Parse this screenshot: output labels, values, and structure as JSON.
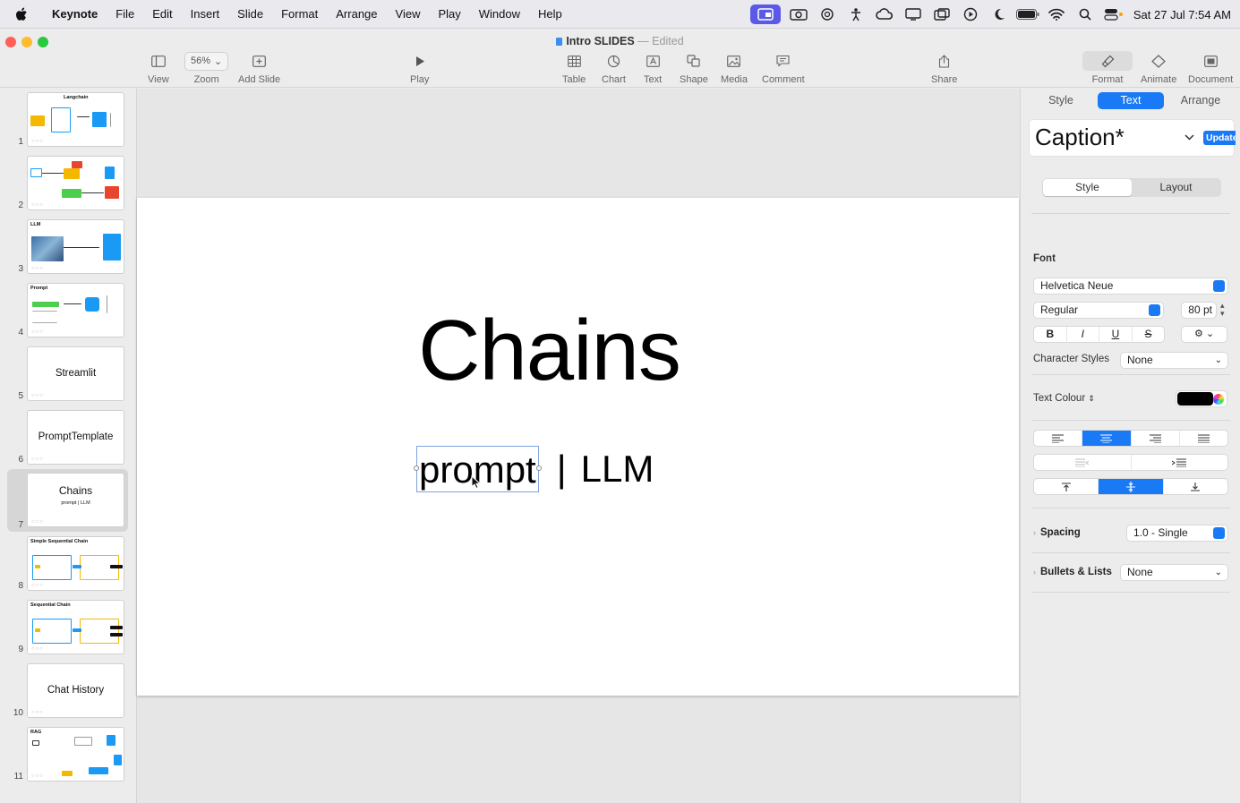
{
  "menubar": {
    "app": "Keynote",
    "items": [
      "File",
      "Edit",
      "Insert",
      "Slide",
      "Format",
      "Arrange",
      "View",
      "Play",
      "Window",
      "Help"
    ],
    "clock": "Sat 27 Jul  7:54 AM"
  },
  "window": {
    "doc_name": "Intro SLIDES",
    "separator": "—",
    "status": "Edited"
  },
  "toolbar": {
    "view": "View",
    "zoom_value": "56%",
    "zoom": "Zoom",
    "add_slide": "Add Slide",
    "play": "Play",
    "table": "Table",
    "chart": "Chart",
    "text": "Text",
    "shape": "Shape",
    "media": "Media",
    "comment": "Comment",
    "share": "Share",
    "format": "Format",
    "animate": "Animate",
    "document": "Document"
  },
  "slides": [
    {
      "num": "1",
      "title": "Langchain"
    },
    {
      "num": "2",
      "title": ""
    },
    {
      "num": "3",
      "title": "LLM"
    },
    {
      "num": "4",
      "title": "Prompt"
    },
    {
      "num": "5",
      "title": "Streamlit"
    },
    {
      "num": "6",
      "title": "PromptTemplate"
    },
    {
      "num": "7",
      "title": "Chains",
      "subtitle": "prompt  |  LLM"
    },
    {
      "num": "8",
      "title": "Simple Sequential Chain"
    },
    {
      "num": "9",
      "title": "Sequential Chain"
    },
    {
      "num": "10",
      "title": "Chat History"
    },
    {
      "num": "11",
      "title": "RAG"
    }
  ],
  "slide": {
    "title": "Chains",
    "sub_word1": "prompt",
    "sub_sep": "|",
    "sub_word2": "LLM"
  },
  "inspector": {
    "tabs": [
      "Style",
      "Text",
      "Arrange"
    ],
    "active_tab": "Text",
    "paragraph_style": "Caption*",
    "update": "Update",
    "subtabs": [
      "Style",
      "Layout"
    ],
    "font_label": "Font",
    "font_family": "Helvetica Neue",
    "font_weight": "Regular",
    "font_size": "80 pt",
    "bold": "B",
    "italic": "I",
    "underline": "U",
    "strike": "S",
    "char_styles_label": "Character Styles",
    "char_styles_value": "None",
    "text_colour_label": "Text Colour",
    "text_colour": "#000000",
    "spacing_label": "Spacing",
    "spacing_value": "1.0 - Single",
    "bullets_label": "Bullets & Lists",
    "bullets_value": "None"
  },
  "colors": {
    "accent": "#1a7af5",
    "menubar_active": "#5a5ae6",
    "orange": "#f5b800",
    "blue": "#1a9af5",
    "red": "#e8452e",
    "green": "#4ccf4c"
  }
}
